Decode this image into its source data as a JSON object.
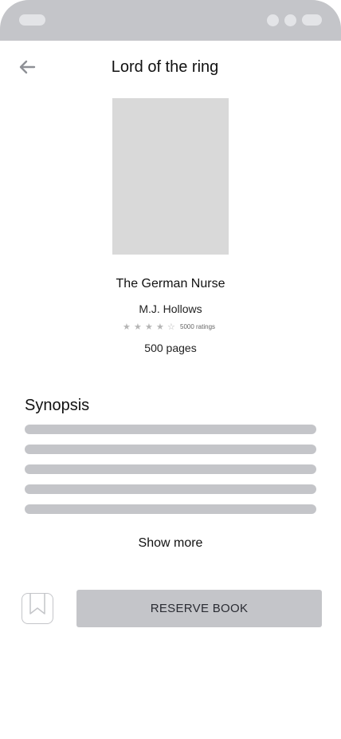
{
  "header": {
    "title": "Lord of the ring",
    "back_icon": "arrow-left-icon"
  },
  "book": {
    "name": "The German Nurse",
    "author": "M.J. Hollows",
    "rating": {
      "stars_filled": 4,
      "stars_total": 5,
      "count_label": "5000 ratings",
      "star_filled_glyph": "★",
      "star_empty_glyph": "☆"
    },
    "pages_label": "500 pages"
  },
  "synopsis": {
    "heading": "Synopsis",
    "show_more_label": "Show more"
  },
  "actions": {
    "bookmark_icon": "bookmark-icon",
    "reserve_label": "RESERVE BOOK"
  },
  "colors": {
    "placeholder_gray": "#c4c5c9",
    "cover_gray": "#d9d9d9",
    "text_dark": "#111111",
    "button_text": "#2a2c33"
  }
}
